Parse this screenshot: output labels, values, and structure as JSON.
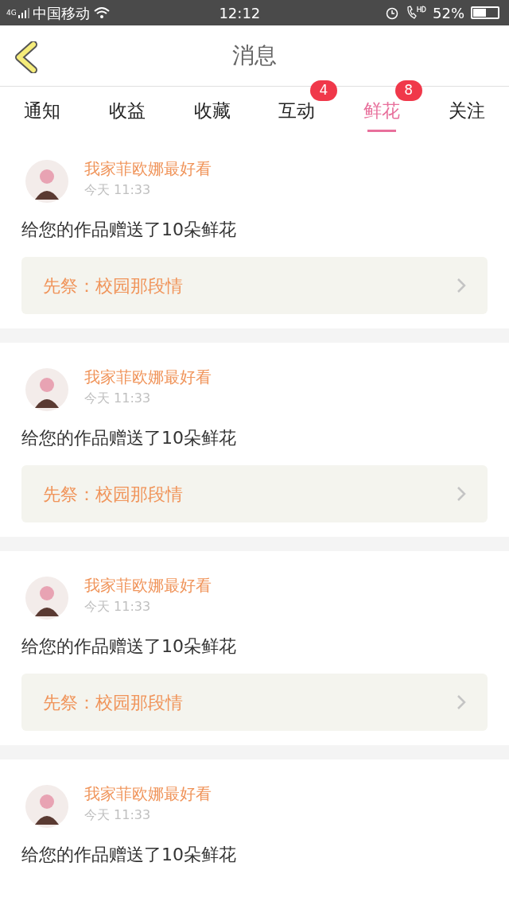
{
  "status_bar": {
    "network": "4G",
    "carrier": "中国移动",
    "time": "12:12",
    "battery_text": "52%"
  },
  "header": {
    "title": "消息"
  },
  "tabs": [
    {
      "label": "通知",
      "selected": false
    },
    {
      "label": "收益",
      "selected": false
    },
    {
      "label": "收藏",
      "selected": false
    },
    {
      "label": "互动",
      "selected": false,
      "badge": "4"
    },
    {
      "label": "鲜花",
      "selected": true,
      "badge": "8"
    },
    {
      "label": "关注",
      "selected": false
    }
  ],
  "messages": [
    {
      "sender": "我家菲欧娜最好看",
      "time": "今天 11:33",
      "text": "给您的作品赠送了10朵鲜花",
      "work": "先祭：校园那段情"
    },
    {
      "sender": "我家菲欧娜最好看",
      "time": "今天 11:33",
      "text": "给您的作品赠送了10朵鲜花",
      "work": "先祭：校园那段情"
    },
    {
      "sender": "我家菲欧娜最好看",
      "time": "今天 11:33",
      "text": "给您的作品赠送了10朵鲜花",
      "work": "先祭：校园那段情"
    },
    {
      "sender": "我家菲欧娜最好看",
      "time": "今天 11:33",
      "text": "给您的作品赠送了10朵鲜花"
    }
  ]
}
